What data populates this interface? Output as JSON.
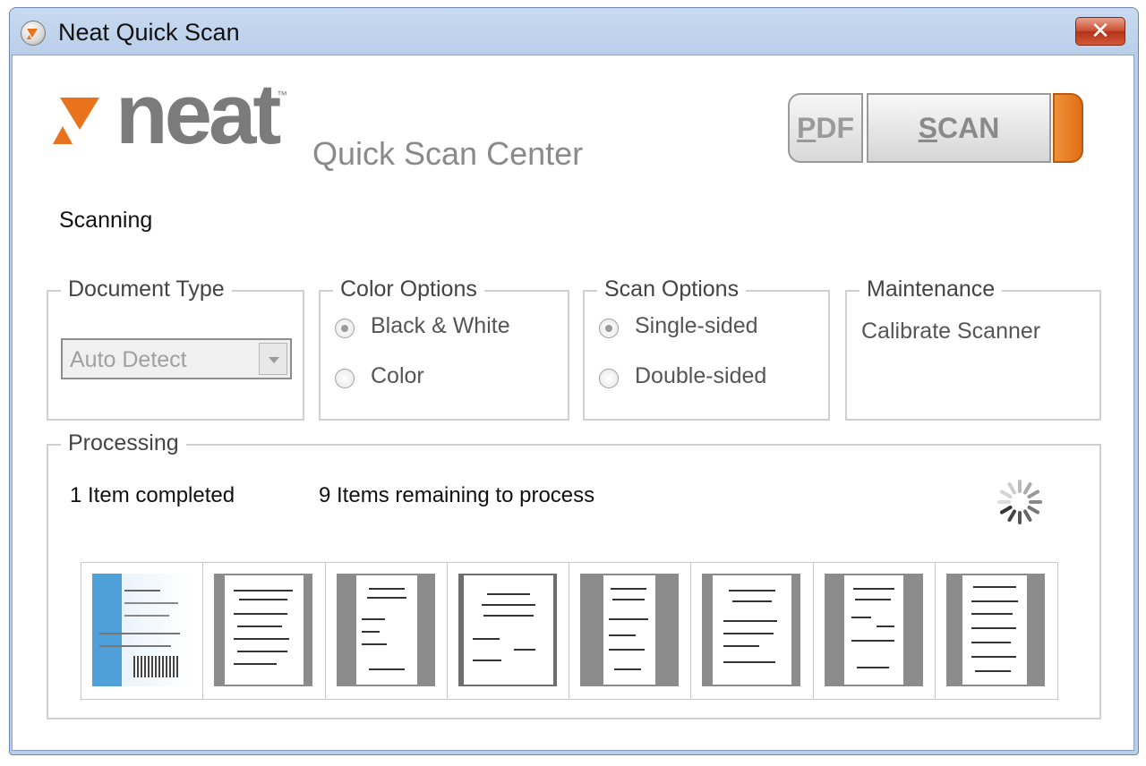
{
  "window": {
    "title": "Neat Quick Scan",
    "close_label": "✕"
  },
  "header": {
    "logo_word": "neat",
    "logo_tm": "™",
    "subtitle": "Quick Scan Center",
    "pdf_button": {
      "first": "P",
      "rest": "DF"
    },
    "scan_button": {
      "first": "S",
      "rest": "CAN"
    },
    "accent_color": "#e8731c"
  },
  "status_text": "Scanning",
  "document_type": {
    "legend": "Document Type",
    "selected": "Auto Detect"
  },
  "color_options": {
    "legend": "Color Options",
    "options": [
      {
        "label": "Black & White",
        "checked": true
      },
      {
        "label": "Color",
        "checked": false
      }
    ]
  },
  "scan_options": {
    "legend": "Scan Options",
    "options": [
      {
        "label": "Single-sided",
        "checked": true
      },
      {
        "label": "Double-sided",
        "checked": false
      }
    ]
  },
  "maintenance": {
    "legend": "Maintenance",
    "link": "Calibrate Scanner"
  },
  "processing": {
    "legend": "Processing",
    "completed_text": "1 Item completed",
    "remaining_text": "9 Items remaining to process",
    "thumbnail_count": 8
  }
}
